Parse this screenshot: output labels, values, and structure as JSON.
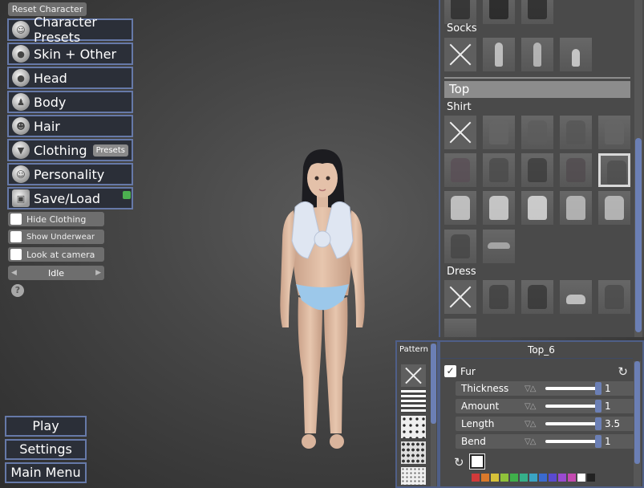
{
  "left_menu": {
    "reset_label": "Reset Character",
    "buttons": [
      {
        "label": "Character Presets",
        "icon": "hair-face-icon"
      },
      {
        "label": "Skin + Other",
        "icon": "body-silhouette-icon"
      },
      {
        "label": "Head",
        "icon": "head-icon"
      },
      {
        "label": "Body",
        "icon": "torso-icon"
      },
      {
        "label": "Hair",
        "icon": "hair-icon"
      },
      {
        "label": "Clothing",
        "icon": "shirt-icon",
        "badge": "Presets"
      },
      {
        "label": "Personality",
        "icon": "smiley-icon"
      },
      {
        "label": "Save/Load",
        "icon": "floppy-disk-icon"
      }
    ],
    "toggles": [
      "Hide Clothing",
      "Show Underwear",
      "Look at camera"
    ],
    "animation": {
      "value": "Idle"
    },
    "help_glyph": "?"
  },
  "bottom_menu": {
    "play": "Play",
    "settings": "Settings",
    "main_menu": "Main Menu"
  },
  "wardrobe": {
    "socks_label": "Socks",
    "category_label": "Top",
    "shirt_label": "Shirt",
    "dress_label": "Dress",
    "selected_item_index": 8
  },
  "pattern_panel": {
    "title": "Pattern"
  },
  "properties": {
    "title": "Top_6",
    "fur": {
      "label": "Fur",
      "checked": true
    },
    "sliders": [
      {
        "label": "Thickness",
        "value": "1",
        "fraction": 1.0
      },
      {
        "label": "Amount",
        "value": "1",
        "fraction": 1.0
      },
      {
        "label": "Length",
        "value": "3.5",
        "fraction": 1.0
      },
      {
        "label": "Bend",
        "value": "1",
        "fraction": 1.0
      }
    ],
    "current_color": "#ffffff",
    "palette": [
      "#d13a3a",
      "#d9792b",
      "#d7c23a",
      "#8fc23a",
      "#3fb04a",
      "#35b08a",
      "#3aa4c4",
      "#3a6ad0",
      "#5a4ad0",
      "#9a4ad0",
      "#c44ab0",
      "#ffffff",
      "#222222"
    ]
  },
  "colors": {
    "accent": "#6679a8",
    "scroll_thumb": "#6b7fb5",
    "panel": "#4a4a4a",
    "status_green": "#4caf50"
  }
}
